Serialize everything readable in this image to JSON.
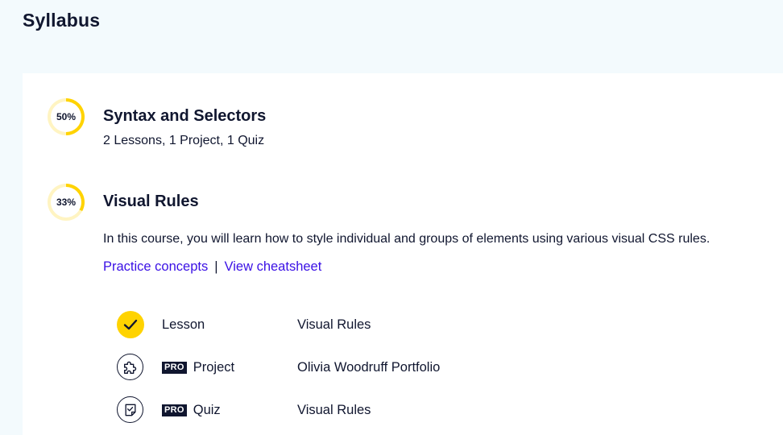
{
  "page": {
    "title": "Syllabus"
  },
  "accent_color": "#ffd300",
  "link_color": "#3a10e5",
  "modules": [
    {
      "progress_label": "50%",
      "progress": 0.5,
      "title": "Syntax and Selectors",
      "summary": "2 Lessons, 1 Project, 1 Quiz"
    },
    {
      "progress_label": "33%",
      "progress": 0.33,
      "title": "Visual Rules",
      "description": "In this course, you will learn how to style individual and groups of elements using various visual CSS rules.",
      "links": {
        "practice": "Practice concepts",
        "separator": "|",
        "cheatsheet": "View cheatsheet"
      },
      "items": [
        {
          "icon": "check-icon",
          "badge": "",
          "type": "Lesson",
          "name": "Visual Rules",
          "completed": true
        },
        {
          "icon": "puzzle-icon",
          "badge": "PRO",
          "type": "Project",
          "name": "Olivia Woodruff Portfolio",
          "completed": false
        },
        {
          "icon": "quiz-icon",
          "badge": "PRO",
          "type": "Quiz",
          "name": "Visual Rules",
          "completed": false
        }
      ]
    }
  ]
}
